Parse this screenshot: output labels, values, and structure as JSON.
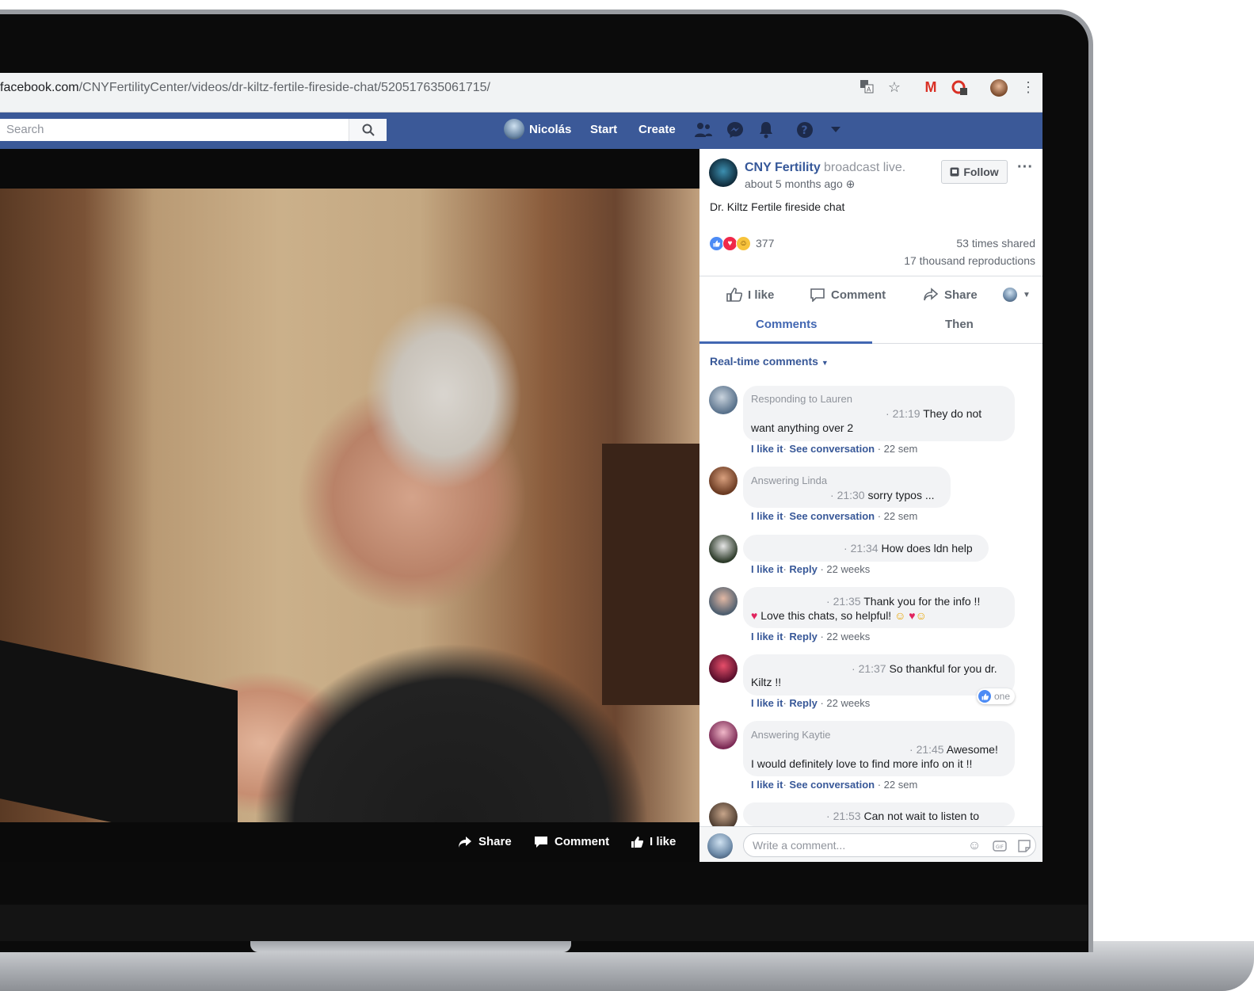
{
  "browser": {
    "url_host": "facebook.com",
    "url_path": "/CNYFertilityCenter/videos/dr-kiltz-fertile-fireside-chat/520517635061715/"
  },
  "fb_nav": {
    "search_placeholder": "Search",
    "profile_name": "Nicolás",
    "start_label": "Start",
    "create_label": "Create"
  },
  "video_controls": {
    "share": "Share",
    "comment": "Comment",
    "like": "I like"
  },
  "post": {
    "page_name": "CNY Fertility",
    "action": "broadcast live.",
    "time": "about 5 months ago",
    "follow_label": "Follow",
    "text": "Dr. Kiltz Fertile fireside chat",
    "reaction_count": "377",
    "shared": "53 times shared",
    "reproductions": "17 thousand reproductions",
    "actions": {
      "like": "I like",
      "comment": "Comment",
      "share": "Share"
    },
    "tabs": {
      "comments": "Comments",
      "then": "Then"
    },
    "filter": "Real-time comments"
  },
  "comments": [
    {
      "reply_to": "Responding to Lauren",
      "time": "21:19",
      "line1": "They do not",
      "line2": "want anything over 2",
      "like": "I like it",
      "action": "See conversation",
      "age": "22 sem"
    },
    {
      "reply_to": "Answering Linda",
      "time": "21:30",
      "line1": "sorry typos ...",
      "like": "I like it",
      "action": "See conversation",
      "age": "22 sem"
    },
    {
      "time": "21:34",
      "line1": "How does ldn help",
      "like": "I like it",
      "action": "Reply",
      "age": "22 weeks"
    },
    {
      "time": "21:35",
      "line1": "Thank you for the info !!",
      "line2": "Love this chats, so helpful!",
      "like": "I like it",
      "action": "Reply",
      "age": "22 weeks"
    },
    {
      "time": "21:37",
      "line1": "So thankful for you dr.",
      "line2": "Kiltz !!",
      "like": "I like it",
      "action": "Reply",
      "age": "22 weeks",
      "like_badge": "one"
    },
    {
      "reply_to": "Answering Kaytie",
      "time": "21:45",
      "line1": "Awesome!",
      "line2": "I would definitely love to find more info on it !!",
      "like": "I like it",
      "action": "See conversation",
      "age": "22 sem"
    },
    {
      "time": "21:53",
      "line1": "Can not wait to listen to"
    }
  ],
  "composer": {
    "placeholder": "Write a comment..."
  },
  "colors": {
    "fb_blue": "#3b5998",
    "link": "#385898",
    "tab_active": "#4267b2"
  }
}
